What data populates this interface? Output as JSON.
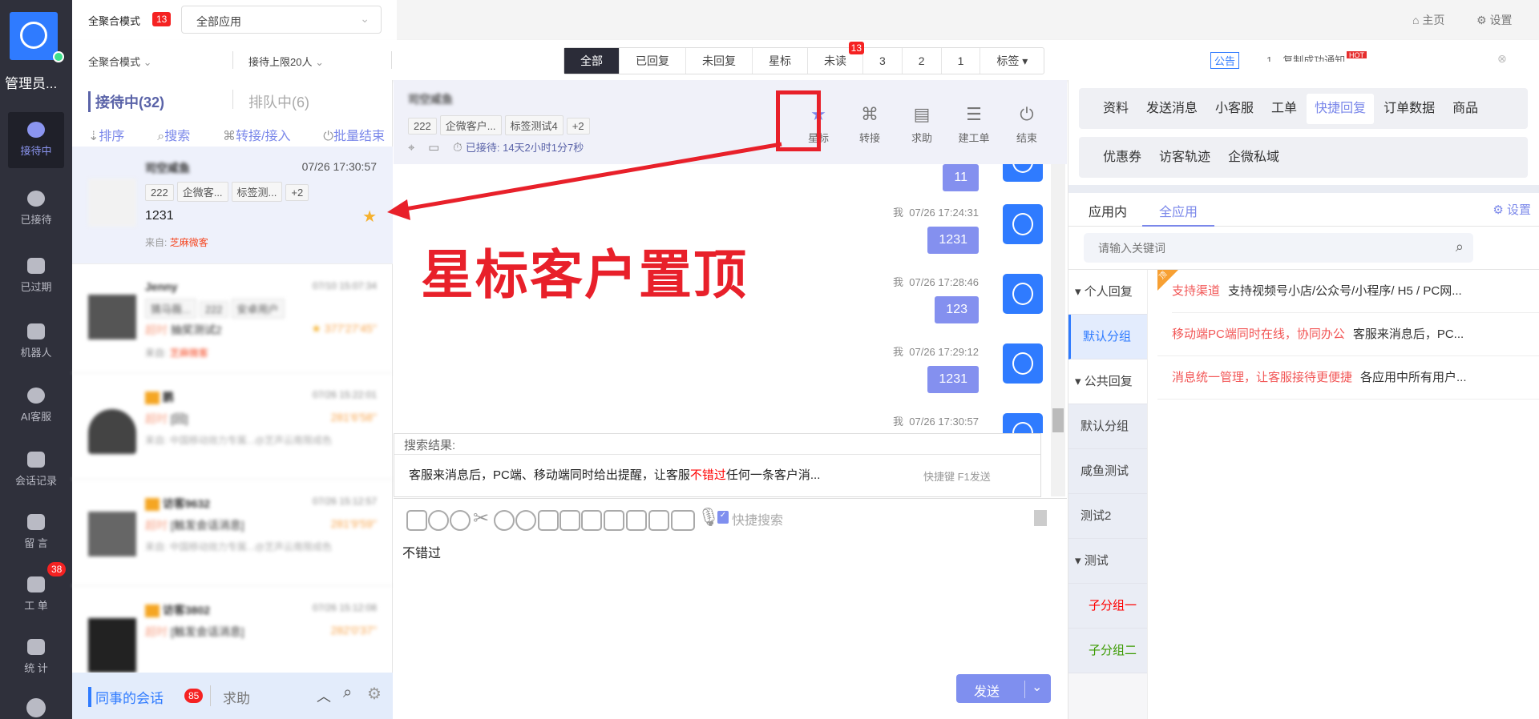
{
  "nav": {
    "user": "管理员...",
    "items": [
      {
        "label": "接待中",
        "icon": "chat-bubble-icon",
        "active": true
      },
      {
        "label": "已接待",
        "icon": "check-icon"
      },
      {
        "label": "已过期",
        "icon": "clock-icon"
      },
      {
        "label": "机器人",
        "icon": "robot-icon"
      },
      {
        "label": "AI客服",
        "icon": "ai-chat-icon"
      },
      {
        "label": "会话记录",
        "icon": "message-log-icon"
      },
      {
        "label": "留 言",
        "icon": "note-icon"
      },
      {
        "label": "工 单",
        "icon": "ticket-icon",
        "badge": "38"
      },
      {
        "label": "统 计",
        "icon": "stats-icon"
      }
    ]
  },
  "top": {
    "mode": "全聚合模式",
    "mode_badge": "13",
    "app_select": "全部应用",
    "home": "主页",
    "settings": "设置"
  },
  "row2": {
    "mode_select": "全聚合模式",
    "limit_select": "接待上限20人",
    "filters": [
      "全部",
      "已回复",
      "未回复",
      "星标",
      "未读",
      "3",
      "2",
      "1",
      "标签 ▾"
    ],
    "unread_badge": "13",
    "notice_label": "公告",
    "notice_text": "1、复制成功通知",
    "hot": "HOT"
  },
  "list": {
    "tab_active": "接待中(32)",
    "tab_queue": "排队中(6)",
    "tools": [
      "排序",
      "搜索",
      "转接/接入",
      "批量结束"
    ],
    "items": [
      {
        "name": "司空咸鱼",
        "time": "07/26 17:30:57",
        "tags": [
          "222",
          "企微客...",
          "标签测...",
          "+2"
        ],
        "msg": "1231",
        "from_label": "来自:",
        "from": "芝麻微客",
        "starred": true
      },
      {
        "name": "Jenny",
        "time": "07/10 15:07:34",
        "tags": [
          "猜马薇...",
          "222",
          "安卓用户"
        ],
        "status": "超时",
        "msg": "抽奖测试2",
        "dur": "377'27'45''",
        "from_label": "来自:",
        "from": "芝麻微客"
      },
      {
        "name": "鹏",
        "time": "07/26 15:22:01",
        "status": "超时",
        "msg": "[回]",
        "dur": "281'6'58''",
        "from_label": "来自:",
        "from": "中国移动效力专属...@芝声云南限成色"
      },
      {
        "name": "访客9632",
        "time": "07/26 15:12:57",
        "status": "超时",
        "msg": "[触发会话消息]",
        "dur": "281'9'59''",
        "from_label": "来自:",
        "from": "中国移动效力专属...@芝声云南限成色"
      },
      {
        "name": "访客3802",
        "time": "07/26 15:12:08",
        "status": "超时",
        "msg": "[触发会话消息]",
        "dur": "282'0'37''"
      }
    ]
  },
  "bottom": {
    "colleague": "同事的会话",
    "colleague_badge": "85",
    "help": "求助"
  },
  "chat": {
    "name": "司空咸鱼",
    "tags": [
      "222",
      "企微客户...",
      "标签测试4",
      "+2"
    ],
    "waited": "已接待: 14天2小时1分7秒",
    "actions": [
      {
        "label": "星标",
        "icon": "star-icon"
      },
      {
        "label": "转接",
        "icon": "transfer-icon"
      },
      {
        "label": "求助",
        "icon": "help-icon"
      },
      {
        "label": "建工单",
        "icon": "ticket-icon"
      },
      {
        "label": "结束",
        "icon": "power-icon"
      }
    ],
    "messages": [
      {
        "sender": "",
        "time": "",
        "text": "11"
      },
      {
        "sender": "我",
        "time": "07/26 17:24:31",
        "text": "1231"
      },
      {
        "sender": "我",
        "time": "07/26 17:28:46",
        "text": "123"
      },
      {
        "sender": "我",
        "time": "07/26 17:29:12",
        "text": "1231"
      },
      {
        "sender": "我",
        "time": "07/26 17:30:57",
        "text": ""
      }
    ],
    "search_title": "搜索结果:",
    "result_pre": "客服来消息后，PC端、移动端同时给出提醒，让客服",
    "result_hl": "不错过",
    "result_post": "任何一条客户消...",
    "shortcut": "快捷键 F1发送",
    "quick_search": "快捷搜索",
    "input": "不错过",
    "send": "发送"
  },
  "annotation": "星标客户置顶",
  "right": {
    "tabs1": [
      "资料",
      "发送消息",
      "小客服",
      "工单",
      "快捷回复",
      "订单数据",
      "商品"
    ],
    "tabs2": [
      "优惠券",
      "访客轨迹",
      "企微私域"
    ],
    "active_tab": "快捷回复",
    "subtabs": [
      "应用内",
      "全应用"
    ],
    "settings": "设置",
    "search_placeholder": "请输入关键词",
    "tree": [
      "个人回复",
      "默认分组",
      "公共回复",
      "默认分组",
      "咸鱼测试",
      "测试2",
      "测试",
      "子分组一",
      "子分组二"
    ],
    "replies": [
      {
        "title": "支持渠道",
        "text": "支持视频号小店/公众号/小程序/ H5 / PC网...",
        "pinned": "顶"
      },
      {
        "title": "移动端PC端同时在线，协同办公",
        "text": "客服来消息后，PC..."
      },
      {
        "title": "消息统一管理，让客服接待更便捷",
        "text": "各应用中所有用户..."
      }
    ]
  },
  "colors": {
    "accent": "#7b88ea",
    "blue": "#2f7bff",
    "red": "#e8202a",
    "nav": "#2f303b"
  }
}
